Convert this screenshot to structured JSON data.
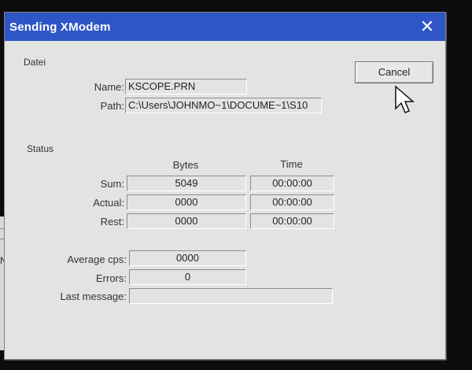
{
  "dialog": {
    "title": "Sending XModem",
    "cancel_label": "Cancel"
  },
  "file_group": {
    "label": "Datei",
    "name_label": "Name:",
    "name_value": "KSCOPE.PRN",
    "path_label": "Path:",
    "path_value": "C:\\Users\\JOHNMO~1\\DOCUME~1\\S10"
  },
  "status_group": {
    "label": "Status",
    "col_bytes": "Bytes",
    "col_time": "Time",
    "rows": [
      {
        "label": "Sum:",
        "bytes": "5049",
        "time": "00:00:00"
      },
      {
        "label": "Actual:",
        "bytes": "0000",
        "time": "00:00:00"
      },
      {
        "label": "Rest:",
        "bytes": "0000",
        "time": "00:00:00"
      }
    ],
    "average_cps_label": "Average cps:",
    "average_cps_value": "0000",
    "errors_label": "Errors:",
    "errors_value": "0",
    "last_message_label": "Last message:",
    "last_message_value": ""
  },
  "background": {
    "partial_label": "NU"
  },
  "colors": {
    "titlebar": "#2e56c7",
    "dialog_bg": "#e2e4e2"
  }
}
